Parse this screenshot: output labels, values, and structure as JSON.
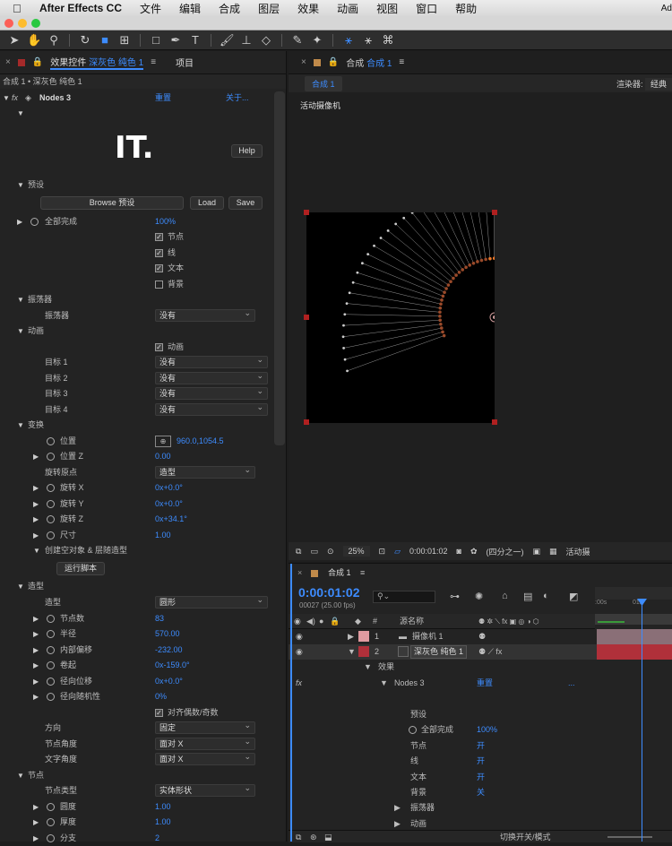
{
  "menubar": {
    "apple": "",
    "app": "After Effects CC",
    "items": [
      "文件",
      "编辑",
      "合成",
      "图层",
      "效果",
      "动画",
      "视图",
      "窗口",
      "帮助"
    ],
    "right": "Ad"
  },
  "effect_panel": {
    "tab_label": "效果控件",
    "tab_layer": "深灰色 纯色 1",
    "project_tab": "项目",
    "breadcrumb": "合成 1 • 深灰色 纯色 1",
    "effect_name": "Nodes 3",
    "reset": "重置",
    "about": "关于...",
    "logo_text": "IT.",
    "help": "Help",
    "presets_header": "预设",
    "browse": "Browse 预设",
    "load": "Load",
    "save": "Save",
    "complete_label": "全部完成",
    "complete_value": "100%",
    "cb_nodes": "节点",
    "cb_lines": "线",
    "cb_text": "文本",
    "cb_bg": "背景",
    "osc_header": "振荡器",
    "osc_label": "振荡器",
    "osc_value": "没有",
    "anim_header": "动画",
    "anim_cb": "动画",
    "target1": "目标 1",
    "target2": "目标 2",
    "target3": "目标 3",
    "target4": "目标 4",
    "none": "没有",
    "transform_header": "变换",
    "pos_label": "位置",
    "pos_value": "960.0,1054.5",
    "posz_label": "位置 Z",
    "posz_value": "0.00",
    "pivot_label": "旋转原点",
    "pivot_value": "造型",
    "rotx_label": "旋转 X",
    "rotx_value": "0x+0.0°",
    "roty_label": "旋转 Y",
    "roty_value": "0x+0.0°",
    "rotz_label": "旋转 Z",
    "rotz_value": "0x+34.1°",
    "scale_label": "尺寸",
    "scale_value": "1.00",
    "create_null": "创建空对象 & 层随造型",
    "run_script": "运行脚本",
    "shape_header": "造型",
    "shape_label": "造型",
    "shape_value": "圆形",
    "count_label": "节点数",
    "count_value": "83",
    "radius_label": "半径",
    "radius_value": "570.00",
    "inner_label": "内部偏移",
    "inner_value": "-232.00",
    "start_label": "卷起",
    "start_value": "0x-159.0°",
    "radial_label": "径向位移",
    "radial_value": "0x+0.0°",
    "random_label": "径向随机性",
    "random_value": "0%",
    "align_cb": "对齐偶数/奇数",
    "dir_label": "方向",
    "dir_value": "固定",
    "nangle_label": "节点角度",
    "nangle_value": "面对 X",
    "tangle_label": "文字角度",
    "tangle_value": "面对 X",
    "node_header": "节点",
    "ntype_label": "节点类型",
    "ntype_value": "实体形状",
    "round_label": "圆度",
    "round_value": "1.00",
    "thick_label": "厚度",
    "thick_value": "1.00",
    "split_label": "分支",
    "split_value": "2"
  },
  "viewer": {
    "tab_label": "合成",
    "tab_comp": "合成 1",
    "sub_tab": "合成 1",
    "renderer_label": "渲染器:",
    "renderer_value": "经典",
    "camera": "活动摄像机",
    "zoom": "25%",
    "time": "0:00:01:02",
    "res": "(四分之一)",
    "active": "活动摄"
  },
  "timeline": {
    "tab": "合成 1",
    "timecode": "0:00:01:02",
    "frames": "00027 (25.00 fps)",
    "search_placeholder": "",
    "col_name": "源名称",
    "ruler_start": ":00s",
    "ruler_mid": "01s",
    "layer1_num": "1",
    "layer1_name": "摄像机 1",
    "layer2_num": "2",
    "layer2_name": "深灰色 纯色 1",
    "effects": "效果",
    "nodes": "Nodes 3",
    "reset": "重置",
    "more": "...",
    "presets": "预设",
    "complete": "全部完成",
    "complete_val": "100%",
    "nodes_p": "节点",
    "nodes_v": "开",
    "lines_p": "线",
    "lines_v": "开",
    "text_p": "文本",
    "text_v": "开",
    "bg_p": "背景",
    "bg_v": "关",
    "osc": "振荡器",
    "anim": "动画",
    "switch": "切换开关/模式"
  },
  "colors": {
    "accent": "#3d8cff",
    "layer_red": "#b0303a",
    "handle": "#b02020"
  }
}
